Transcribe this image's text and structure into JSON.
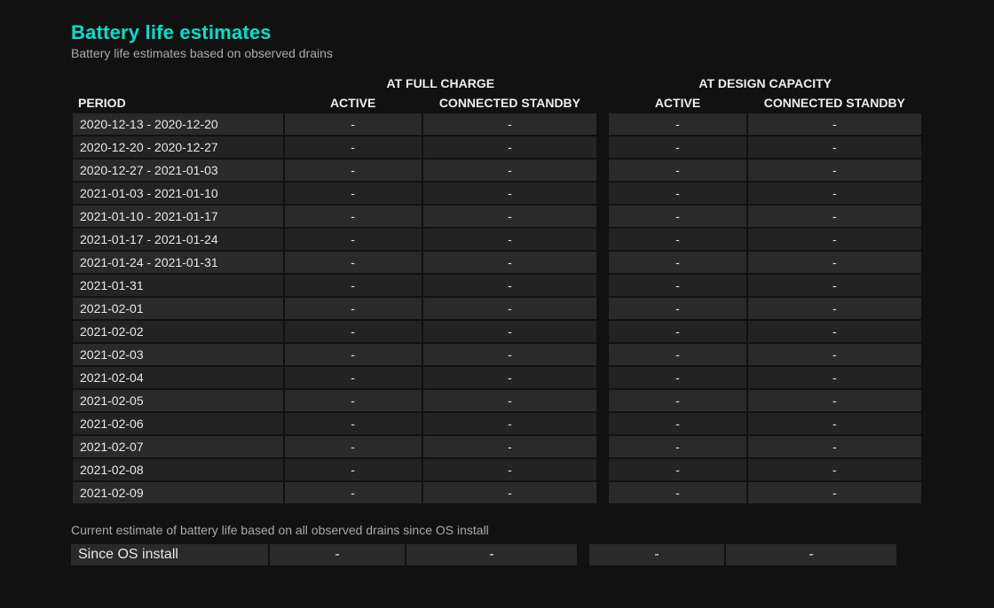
{
  "title": "Battery life estimates",
  "subtitle": "Battery life estimates based on observed drains",
  "headers": {
    "period": "PERIOD",
    "full_charge": "AT FULL CHARGE",
    "design_capacity": "AT DESIGN CAPACITY",
    "active": "ACTIVE",
    "standby": "CONNECTED STANDBY"
  },
  "rows": [
    {
      "period": "2020-12-13 - 2020-12-20",
      "fc_active": "-",
      "fc_standby": "-",
      "dc_active": "-",
      "dc_standby": "-"
    },
    {
      "period": "2020-12-20 - 2020-12-27",
      "fc_active": "-",
      "fc_standby": "-",
      "dc_active": "-",
      "dc_standby": "-"
    },
    {
      "period": "2020-12-27 - 2021-01-03",
      "fc_active": "-",
      "fc_standby": "-",
      "dc_active": "-",
      "dc_standby": "-"
    },
    {
      "period": "2021-01-03 - 2021-01-10",
      "fc_active": "-",
      "fc_standby": "-",
      "dc_active": "-",
      "dc_standby": "-"
    },
    {
      "period": "2021-01-10 - 2021-01-17",
      "fc_active": "-",
      "fc_standby": "-",
      "dc_active": "-",
      "dc_standby": "-"
    },
    {
      "period": "2021-01-17 - 2021-01-24",
      "fc_active": "-",
      "fc_standby": "-",
      "dc_active": "-",
      "dc_standby": "-"
    },
    {
      "period": "2021-01-24 - 2021-01-31",
      "fc_active": "-",
      "fc_standby": "-",
      "dc_active": "-",
      "dc_standby": "-"
    },
    {
      "period": "2021-01-31",
      "fc_active": "-",
      "fc_standby": "-",
      "dc_active": "-",
      "dc_standby": "-"
    },
    {
      "period": "2021-02-01",
      "fc_active": "-",
      "fc_standby": "-",
      "dc_active": "-",
      "dc_standby": "-"
    },
    {
      "period": "2021-02-02",
      "fc_active": "-",
      "fc_standby": "-",
      "dc_active": "-",
      "dc_standby": "-"
    },
    {
      "period": "2021-02-03",
      "fc_active": "-",
      "fc_standby": "-",
      "dc_active": "-",
      "dc_standby": "-"
    },
    {
      "period": "2021-02-04",
      "fc_active": "-",
      "fc_standby": "-",
      "dc_active": "-",
      "dc_standby": "-"
    },
    {
      "period": "2021-02-05",
      "fc_active": "-",
      "fc_standby": "-",
      "dc_active": "-",
      "dc_standby": "-"
    },
    {
      "period": "2021-02-06",
      "fc_active": "-",
      "fc_standby": "-",
      "dc_active": "-",
      "dc_standby": "-"
    },
    {
      "period": "2021-02-07",
      "fc_active": "-",
      "fc_standby": "-",
      "dc_active": "-",
      "dc_standby": "-"
    },
    {
      "period": "2021-02-08",
      "fc_active": "-",
      "fc_standby": "-",
      "dc_active": "-",
      "dc_standby": "-"
    },
    {
      "period": "2021-02-09",
      "fc_active": "-",
      "fc_standby": "-",
      "dc_active": "-",
      "dc_standby": "-"
    }
  ],
  "footnote": "Current estimate of battery life based on all observed drains since OS install",
  "since_install": {
    "label": "Since OS install",
    "fc_active": "-",
    "fc_standby": "-",
    "dc_active": "-",
    "dc_standby": "-"
  }
}
